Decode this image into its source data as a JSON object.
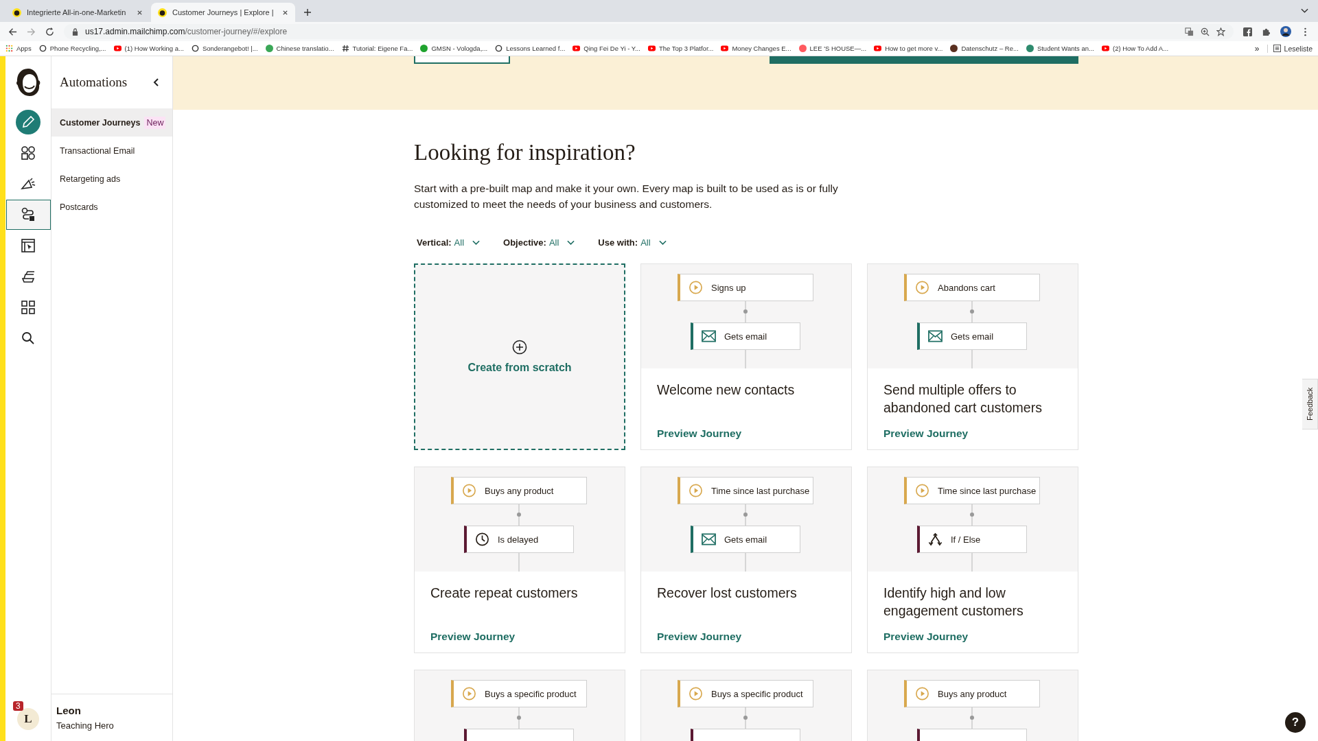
{
  "browser": {
    "tabs": [
      {
        "title": "Integrierte All-in-one-Marketin",
        "selected": false
      },
      {
        "title": "Customer Journeys | Explore |",
        "selected": true
      }
    ],
    "url_host": "us17.admin.mailchimp.com",
    "url_path": "/customer-journey/#/explore",
    "bookmarks": [
      {
        "label": "Apps",
        "kind": "apps"
      },
      {
        "label": "Phone Recycling,...",
        "kind": "ring"
      },
      {
        "label": "(1) How Working a...",
        "kind": "video"
      },
      {
        "label": "Sonderangebot! |...",
        "kind": "ring"
      },
      {
        "label": "Chinese translatio...",
        "kind": "dot",
        "color": "#3aa757"
      },
      {
        "label": "Tutorial: Eigene Fa...",
        "kind": "hash"
      },
      {
        "label": "GMSN - Vologda,...",
        "kind": "dot",
        "color": "#1fa32e"
      },
      {
        "label": "Lessons Learned f...",
        "kind": "ring"
      },
      {
        "label": "Qing Fei De Yi - Y...",
        "kind": "video"
      },
      {
        "label": "The Top 3 Platfor...",
        "kind": "video"
      },
      {
        "label": "Money Changes E...",
        "kind": "video"
      },
      {
        "label": "LEE 'S HOUSE—...",
        "kind": "dot",
        "color": "#ff5a5f"
      },
      {
        "label": "How to get more v...",
        "kind": "video"
      },
      {
        "label": "Datenschutz – Re...",
        "kind": "dot",
        "color": "#5a3020"
      },
      {
        "label": "Student Wants an...",
        "kind": "dot",
        "color": "#2e8b6e"
      },
      {
        "label": "(2) How To Add A...",
        "kind": "video"
      }
    ],
    "more": "»",
    "reading_list": "Leseliste"
  },
  "rail": [
    {
      "kind": "pencil",
      "selected": false
    },
    {
      "kind": "audience",
      "selected": false
    },
    {
      "kind": "megaphone",
      "selected": false
    },
    {
      "kind": "automation",
      "selected": true
    },
    {
      "kind": "website",
      "selected": false
    },
    {
      "kind": "content",
      "selected": false
    },
    {
      "kind": "grid",
      "selected": false
    },
    {
      "kind": "search",
      "selected": false
    }
  ],
  "sidebar": {
    "title": "Automations",
    "items": [
      {
        "label": "Customer Journeys",
        "badge": "New",
        "selected": true
      },
      {
        "label": "Transactional Email",
        "selected": false
      },
      {
        "label": "Retargeting ads",
        "selected": false
      },
      {
        "label": "Postcards",
        "selected": false
      }
    ],
    "user": {
      "initial": "L",
      "notifications": "3",
      "name": "Leon",
      "role": "Teaching Hero"
    }
  },
  "main": {
    "heading": "Looking for inspiration?",
    "intro": "Start with a pre-built map and make it your own. Every map is built to be used as is or fully customized to meet the needs of your business and customers.",
    "filters": [
      {
        "label": "Vertical:",
        "value": "All"
      },
      {
        "label": "Objective:",
        "value": "All"
      },
      {
        "label": "Use with:",
        "value": "All"
      }
    ],
    "create": "Create from scratch",
    "journeys": [
      {
        "steps": [
          {
            "kind": "trigger",
            "label": "Signs up"
          },
          {
            "kind": "email",
            "label": "Gets email"
          }
        ],
        "title": "Welcome new contacts",
        "link": "Preview Journey"
      },
      {
        "steps": [
          {
            "kind": "trigger",
            "label": "Abandons cart"
          },
          {
            "kind": "email",
            "label": "Gets email"
          }
        ],
        "title": "Send multiple offers to abandoned cart customers",
        "link": "Preview Journey"
      },
      {
        "steps": [
          {
            "kind": "trigger",
            "label": "Buys any product"
          },
          {
            "kind": "delay",
            "label": "Is delayed"
          }
        ],
        "title": "Create repeat customers",
        "link": "Preview Journey"
      },
      {
        "steps": [
          {
            "kind": "trigger",
            "label": "Time since last purchase"
          },
          {
            "kind": "email",
            "label": "Gets email"
          }
        ],
        "title": "Recover lost customers",
        "link": "Preview Journey"
      },
      {
        "steps": [
          {
            "kind": "trigger",
            "label": "Time since last purchase"
          },
          {
            "kind": "ifelse",
            "label": "If / Else"
          }
        ],
        "title": "Identify high and low engagement customers",
        "link": "Preview Journey"
      },
      {
        "steps": [
          {
            "kind": "trigger",
            "label": "Buys a specific product"
          },
          {
            "kind": "rule"
          }
        ]
      },
      {
        "steps": [
          {
            "kind": "trigger",
            "label": "Buys a specific product"
          },
          {
            "kind": "rule"
          }
        ]
      },
      {
        "steps": [
          {
            "kind": "trigger",
            "label": "Buys any product"
          },
          {
            "kind": "rule"
          }
        ]
      }
    ]
  },
  "feedback": "Feedback",
  "help": "?"
}
